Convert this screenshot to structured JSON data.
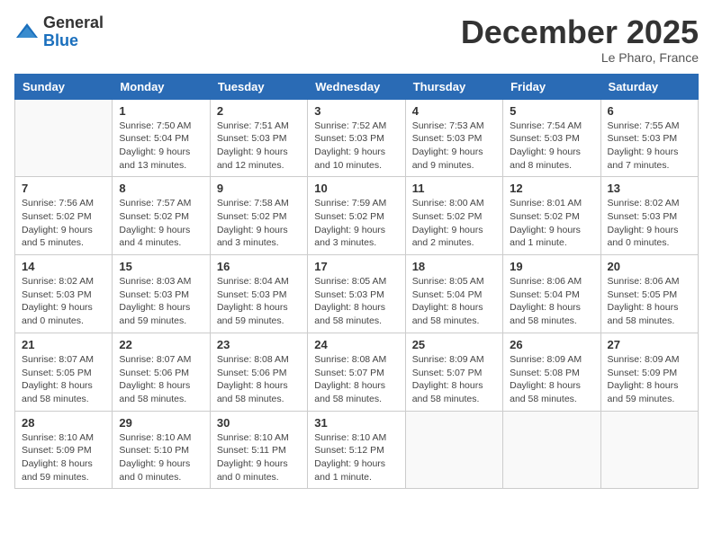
{
  "logo": {
    "general": "General",
    "blue": "Blue"
  },
  "header": {
    "month": "December 2025",
    "location": "Le Pharo, France"
  },
  "weekdays": [
    "Sunday",
    "Monday",
    "Tuesday",
    "Wednesday",
    "Thursday",
    "Friday",
    "Saturday"
  ],
  "weeks": [
    [
      {
        "day": "",
        "sunrise": "",
        "sunset": "",
        "daylight": ""
      },
      {
        "day": "1",
        "sunrise": "7:50 AM",
        "sunset": "5:04 PM",
        "daylight": "9 hours and 13 minutes."
      },
      {
        "day": "2",
        "sunrise": "7:51 AM",
        "sunset": "5:03 PM",
        "daylight": "9 hours and 12 minutes."
      },
      {
        "day": "3",
        "sunrise": "7:52 AM",
        "sunset": "5:03 PM",
        "daylight": "9 hours and 10 minutes."
      },
      {
        "day": "4",
        "sunrise": "7:53 AM",
        "sunset": "5:03 PM",
        "daylight": "9 hours and 9 minutes."
      },
      {
        "day": "5",
        "sunrise": "7:54 AM",
        "sunset": "5:03 PM",
        "daylight": "9 hours and 8 minutes."
      },
      {
        "day": "6",
        "sunrise": "7:55 AM",
        "sunset": "5:03 PM",
        "daylight": "9 hours and 7 minutes."
      }
    ],
    [
      {
        "day": "7",
        "sunrise": "7:56 AM",
        "sunset": "5:02 PM",
        "daylight": "9 hours and 5 minutes."
      },
      {
        "day": "8",
        "sunrise": "7:57 AM",
        "sunset": "5:02 PM",
        "daylight": "9 hours and 4 minutes."
      },
      {
        "day": "9",
        "sunrise": "7:58 AM",
        "sunset": "5:02 PM",
        "daylight": "9 hours and 3 minutes."
      },
      {
        "day": "10",
        "sunrise": "7:59 AM",
        "sunset": "5:02 PM",
        "daylight": "9 hours and 3 minutes."
      },
      {
        "day": "11",
        "sunrise": "8:00 AM",
        "sunset": "5:02 PM",
        "daylight": "9 hours and 2 minutes."
      },
      {
        "day": "12",
        "sunrise": "8:01 AM",
        "sunset": "5:02 PM",
        "daylight": "9 hours and 1 minute."
      },
      {
        "day": "13",
        "sunrise": "8:02 AM",
        "sunset": "5:03 PM",
        "daylight": "9 hours and 0 minutes."
      }
    ],
    [
      {
        "day": "14",
        "sunrise": "8:02 AM",
        "sunset": "5:03 PM",
        "daylight": "9 hours and 0 minutes."
      },
      {
        "day": "15",
        "sunrise": "8:03 AM",
        "sunset": "5:03 PM",
        "daylight": "8 hours and 59 minutes."
      },
      {
        "day": "16",
        "sunrise": "8:04 AM",
        "sunset": "5:03 PM",
        "daylight": "8 hours and 59 minutes."
      },
      {
        "day": "17",
        "sunrise": "8:05 AM",
        "sunset": "5:03 PM",
        "daylight": "8 hours and 58 minutes."
      },
      {
        "day": "18",
        "sunrise": "8:05 AM",
        "sunset": "5:04 PM",
        "daylight": "8 hours and 58 minutes."
      },
      {
        "day": "19",
        "sunrise": "8:06 AM",
        "sunset": "5:04 PM",
        "daylight": "8 hours and 58 minutes."
      },
      {
        "day": "20",
        "sunrise": "8:06 AM",
        "sunset": "5:05 PM",
        "daylight": "8 hours and 58 minutes."
      }
    ],
    [
      {
        "day": "21",
        "sunrise": "8:07 AM",
        "sunset": "5:05 PM",
        "daylight": "8 hours and 58 minutes."
      },
      {
        "day": "22",
        "sunrise": "8:07 AM",
        "sunset": "5:06 PM",
        "daylight": "8 hours and 58 minutes."
      },
      {
        "day": "23",
        "sunrise": "8:08 AM",
        "sunset": "5:06 PM",
        "daylight": "8 hours and 58 minutes."
      },
      {
        "day": "24",
        "sunrise": "8:08 AM",
        "sunset": "5:07 PM",
        "daylight": "8 hours and 58 minutes."
      },
      {
        "day": "25",
        "sunrise": "8:09 AM",
        "sunset": "5:07 PM",
        "daylight": "8 hours and 58 minutes."
      },
      {
        "day": "26",
        "sunrise": "8:09 AM",
        "sunset": "5:08 PM",
        "daylight": "8 hours and 58 minutes."
      },
      {
        "day": "27",
        "sunrise": "8:09 AM",
        "sunset": "5:09 PM",
        "daylight": "8 hours and 59 minutes."
      }
    ],
    [
      {
        "day": "28",
        "sunrise": "8:10 AM",
        "sunset": "5:09 PM",
        "daylight": "8 hours and 59 minutes."
      },
      {
        "day": "29",
        "sunrise": "8:10 AM",
        "sunset": "5:10 PM",
        "daylight": "9 hours and 0 minutes."
      },
      {
        "day": "30",
        "sunrise": "8:10 AM",
        "sunset": "5:11 PM",
        "daylight": "9 hours and 0 minutes."
      },
      {
        "day": "31",
        "sunrise": "8:10 AM",
        "sunset": "5:12 PM",
        "daylight": "9 hours and 1 minute."
      },
      {
        "day": "",
        "sunrise": "",
        "sunset": "",
        "daylight": ""
      },
      {
        "day": "",
        "sunrise": "",
        "sunset": "",
        "daylight": ""
      },
      {
        "day": "",
        "sunrise": "",
        "sunset": "",
        "daylight": ""
      }
    ]
  ]
}
